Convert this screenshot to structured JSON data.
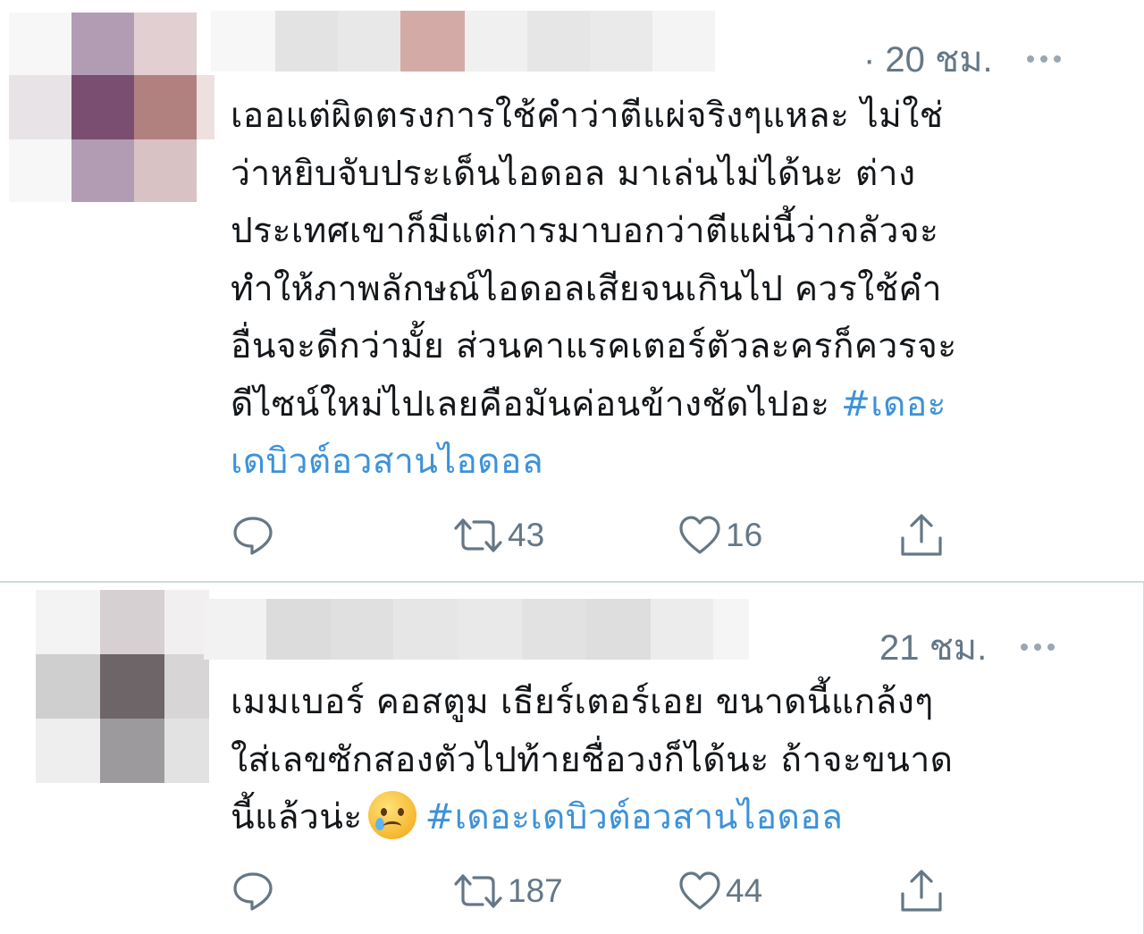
{
  "tweets": [
    {
      "time": "· 20 ชม.",
      "lines": [
        {
          "text": "เออแต่ผิดตรงการใช้คำว่าตีแผ่จริงๆแหละ ไม่ใช่"
        },
        {
          "text": "ว่าหยิบจับประเด็นไอดอล มาเล่นไม่ได้นะ ต่าง"
        },
        {
          "text": "ประเทศเขาก็มีแต่การมาบอกว่าตีแผ่นี้ว่ากลัวจะ"
        },
        {
          "text": "ทำให้ภาพลักษณ์ไอดอลเสียจนเกินไป ควรใช้คำ"
        },
        {
          "text": "อื่นจะดีกว่ามั้ย ส่วนคาแรคเตอร์ตัวละครก็ควรจะ"
        },
        {
          "text": "ดีไซน์ใหม่ไปเลยคือมันค่อนข้างชัดไปอะ ",
          "hashtag": "#เดอะ"
        },
        {
          "text": "",
          "hashtag": "เดบิวต์อวสานไอดอล"
        }
      ],
      "retweets": "43",
      "likes": "16"
    },
    {
      "time": "21 ชม.",
      "lines": [
        {
          "text": "เมมเบอร์ คอสตูม เธียร์เตอร์เอย ขนาดนี้แกล้งๆ"
        },
        {
          "text": "ใส่เลขซักสองตัวไปท้ายชื่อวงก็ได้นะ ถ้าจะขนาด"
        },
        {
          "text": "นี้แล้วน่ะ",
          "hashtag": "#เดอะเดบิวต์อวสานไอดอล"
        }
      ],
      "retweets": "187",
      "likes": "44"
    }
  ],
  "icons": {
    "reply": "reply-icon",
    "retweet": "retweet-icon",
    "like": "like-icon",
    "share": "share-icon",
    "more": "more-icon",
    "emoji": "tearful-smile-emoji"
  },
  "colors": {
    "hashtag": "#3d92d8",
    "meta": "#657786",
    "text": "#14171a",
    "divider": "#cfd9de"
  },
  "avatar_1_colors": [
    "#f8f7f8",
    "#b29cb4",
    "#e1cfd1",
    "#ffffff",
    "#e7e3e6",
    "#794e71",
    "#b1817f",
    "#efe0e0",
    "#f8f7f8",
    "#b29cb4",
    "#d9c2c4",
    "#ffffff"
  ],
  "avatar_2_colors": [
    "#f3f3f3",
    "#d6d0d3",
    "#f2eff0",
    "#cfcfcf",
    "#6e6569",
    "#d8d5d7",
    "#eeeeee",
    "#9c9a9d",
    "#e3e2e3"
  ],
  "name_bar_1_colors": [
    "#f7f7f7",
    "#e3e3e3",
    "#e8e8e8",
    "#d4aaa7",
    "#f0f0f0",
    "#e6e6e6",
    "#eaeaea",
    "#f4f4f4"
  ],
  "name_bar_2_colors": [
    "#f2f2f2",
    "#dcdcdc",
    "#e0e0e0",
    "#e6e6e6",
    "#e9e9e9",
    "#e2e2e2",
    "#dedede",
    "#ececec",
    "#f5f5f5"
  ]
}
